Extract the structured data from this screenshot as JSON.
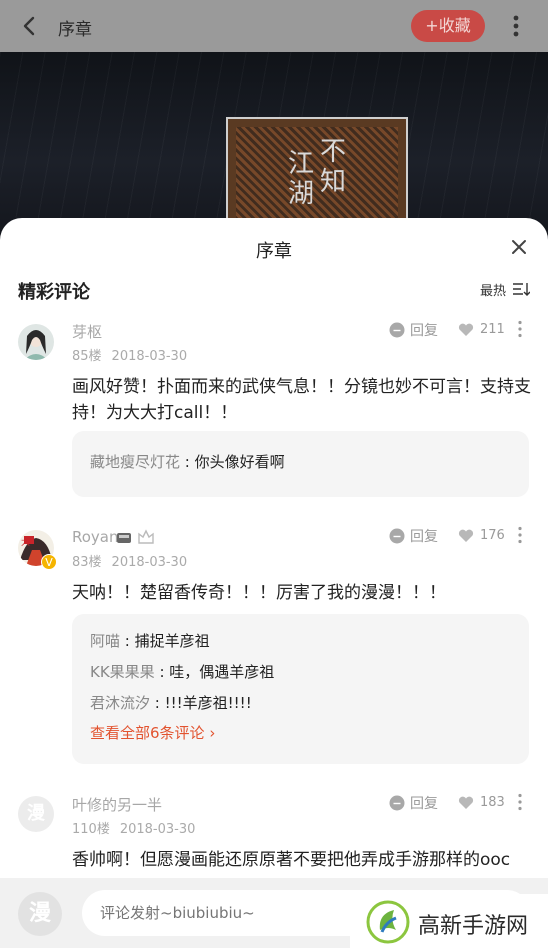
{
  "topbar": {
    "title": "序章",
    "fav_label": "+收藏"
  },
  "cover": {
    "col1": "江湖",
    "col2": "不知"
  },
  "sheet": {
    "title": "序章"
  },
  "section": {
    "title": "精彩评论",
    "sort_label": "最热"
  },
  "comments": [
    {
      "username": "芽枢",
      "floor": "85楼",
      "date": "2018-03-30",
      "reply_label": "回复",
      "likes": "211",
      "text": "画风好赞！扑面而来的武侠气息！！分镜也妙不可言！支持支持！为大大打call！！",
      "replies": [
        {
          "user": "藏地瘦尽灯花",
          "text": "你头像好看啊"
        }
      ]
    },
    {
      "username": "Royan",
      "floor": "83楼",
      "date": "2018-03-30",
      "reply_label": "回复",
      "likes": "176",
      "text": "天呐！！楚留香传奇！！！厉害了我的漫漫！！！",
      "replies": [
        {
          "user": "阿喵",
          "text": "捕捉羊彦祖"
        },
        {
          "user": "KK果果果",
          "text": "哇，偶遇羊彦祖"
        },
        {
          "user": "君沐流汐",
          "text": "!!!羊彦祖!!!!"
        }
      ],
      "view_all": "查看全部6条评论"
    },
    {
      "username": "叶修的另一半",
      "floor": "110楼",
      "date": "2018-03-30",
      "reply_label": "回复",
      "likes": "183",
      "text": "香帅啊！但愿漫画能还原原著不要把他弄成手游那样的ooc",
      "avatar_char": "漫"
    }
  ],
  "bottom": {
    "avatar_char": "漫",
    "input_placeholder": "评论发射~biubiubiu~"
  },
  "watermark": {
    "text": "高新手游网"
  },
  "colors": {
    "accent": "#e2532f",
    "fav_bg": "#c94a46"
  }
}
